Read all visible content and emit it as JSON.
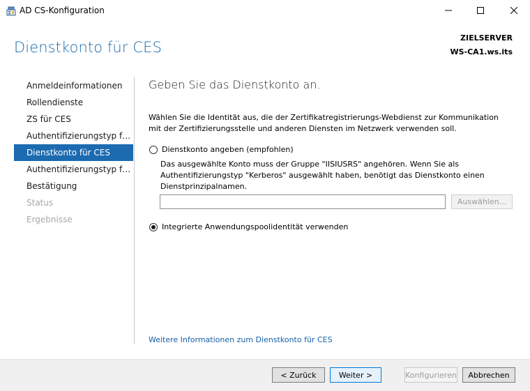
{
  "window": {
    "title": "AD CS-Konfiguration"
  },
  "header": {
    "title": "Dienstkonto für CES",
    "target_label": "ZIELSERVER",
    "target_name": "WS-CA1.ws.its"
  },
  "nav": {
    "items": [
      {
        "label": "Anmeldeinformationen",
        "state": "normal"
      },
      {
        "label": "Rollendienste",
        "state": "normal"
      },
      {
        "label": "ZS für CES",
        "state": "normal"
      },
      {
        "label": "Authentifizierungstyp für…",
        "state": "normal"
      },
      {
        "label": "Dienstkonto für CES",
        "state": "active"
      },
      {
        "label": "Authentifizierungstyp für…",
        "state": "normal"
      },
      {
        "label": "Bestätigung",
        "state": "normal"
      },
      {
        "label": "Status",
        "state": "disabled"
      },
      {
        "label": "Ergebnisse",
        "state": "disabled"
      }
    ]
  },
  "content": {
    "heading": "Geben Sie das Dienstkonto an.",
    "intro": "Wählen Sie die Identität aus, die der Zertifikatregistrierungs-Webdienst zur Kommunikation mit der Zertifizierungsstelle und anderen Diensten im Netzwerk verwenden soll.",
    "option_account": {
      "label": "Dienstkonto angeben (empfohlen)",
      "checked": false,
      "hint": "Das ausgewählte Konto muss der Gruppe \"IISIUSRS\" angehören. Wenn Sie als Authentifizierungstyp \"Kerberos\" ausgewählt haben, benötigt das Dienstkonto einen Dienstprinzipalnamen.",
      "value": "",
      "select_label": "Auswählen..."
    },
    "option_pool": {
      "label": "Integrierte Anwendungspoolidentität verwenden",
      "checked": true
    },
    "more_link": "Weitere Informationen zum Dienstkonto für CES"
  },
  "footer": {
    "back": "< Zurück",
    "next": "Weiter >",
    "configure": "Konfigurieren",
    "cancel": "Abbrechen"
  },
  "colors": {
    "accent": "#1c6ab0",
    "title_blue": "#1e6aa8",
    "link": "#1660a8"
  }
}
